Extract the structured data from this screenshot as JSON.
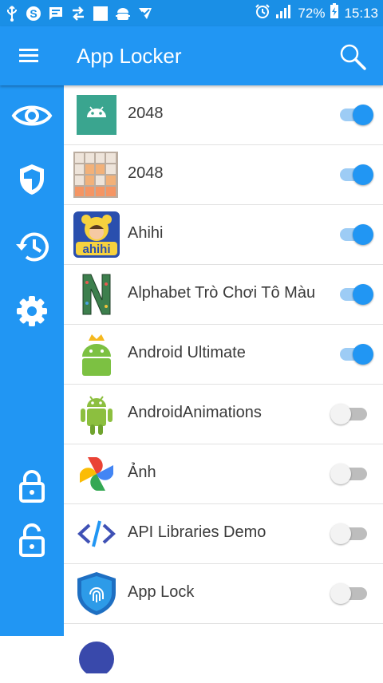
{
  "status_bar": {
    "battery": "72%",
    "time": "15:13",
    "icons": [
      "usb-icon",
      "skype-icon",
      "message-icon",
      "transfer-icon",
      "square-icon",
      "android-debug-icon",
      "inbox-check-icon",
      "alarm-icon",
      "signal-icon",
      "battery-icon"
    ]
  },
  "app_bar": {
    "title": "App Locker",
    "menu_icon": "menu-icon",
    "search_icon": "search-icon"
  },
  "rail": {
    "items": [
      "eye-icon",
      "shield-icon",
      "history-icon",
      "gear-icon",
      "lock-icon",
      "unlock-icon"
    ]
  },
  "apps": [
    {
      "name": "2048",
      "locked": true,
      "icon": "android-tile-icon"
    },
    {
      "name": "2048",
      "locked": true,
      "icon": "grid-2048-icon"
    },
    {
      "name": "Ahihi",
      "locked": true,
      "icon": "ahihi-icon"
    },
    {
      "name": "Alphabet Trò Chơi Tô Màu",
      "locked": true,
      "icon": "alphabet-n-icon"
    },
    {
      "name": "Android Ultimate",
      "locked": true,
      "icon": "android-crown-icon"
    },
    {
      "name": "AndroidAnimations",
      "locked": false,
      "icon": "android-robot-icon"
    },
    {
      "name": "Ảnh",
      "locked": false,
      "icon": "photos-pinwheel-icon"
    },
    {
      "name": "API Libraries Demo",
      "locked": false,
      "icon": "code-brackets-icon"
    },
    {
      "name": "App Lock",
      "locked": false,
      "icon": "fingerprint-shield-icon"
    }
  ],
  "colors": {
    "primary": "#2196f3",
    "status_bar": "#1a8fe6",
    "toggle_on_track": "#9dccf5",
    "toggle_off_track": "#bdbdbd"
  }
}
